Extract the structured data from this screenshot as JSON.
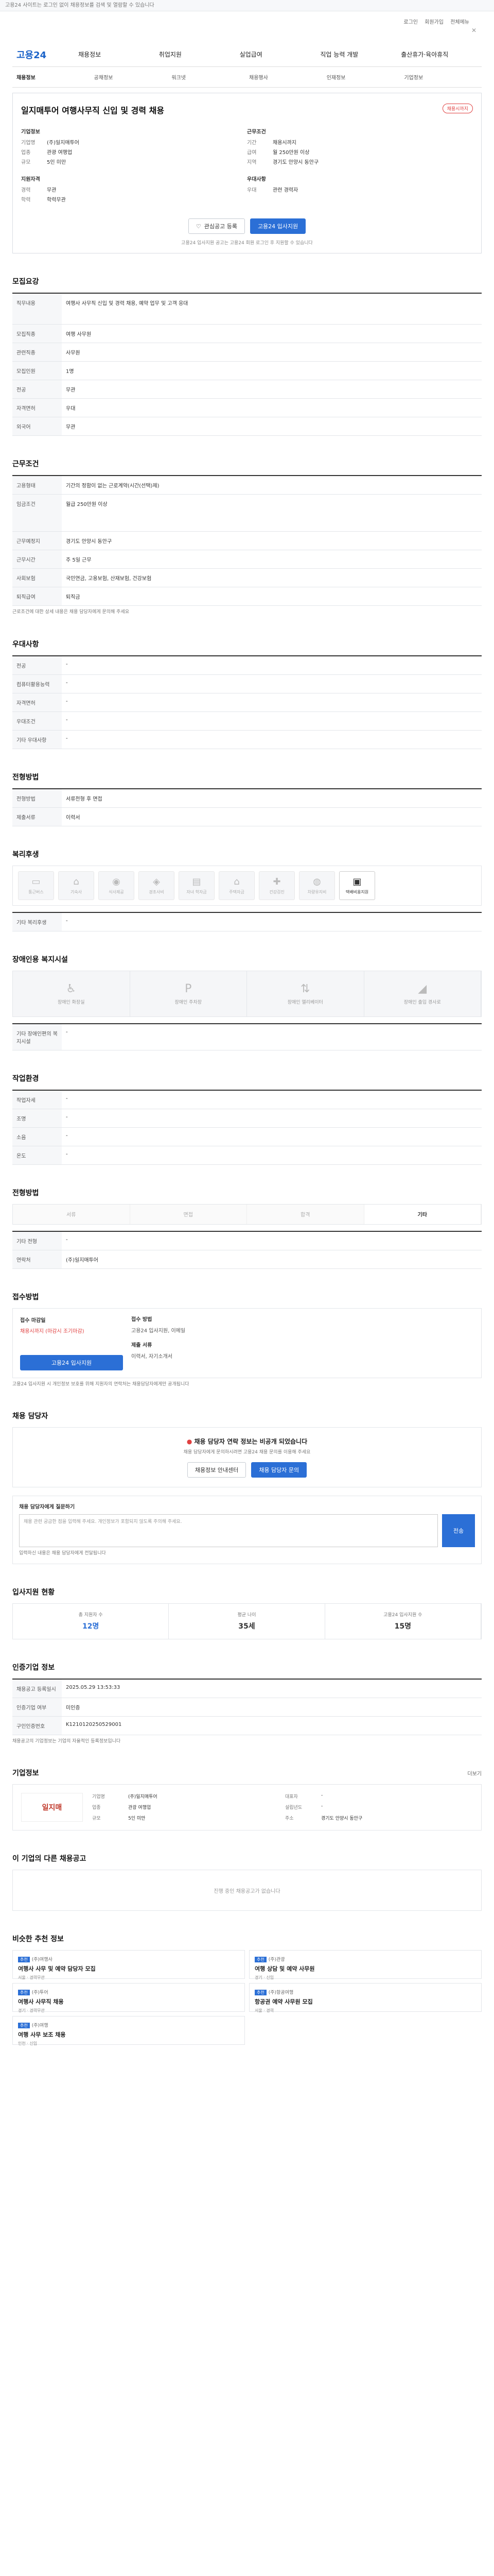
{
  "topbar": {
    "note": "고용24 사이트는 로그인 없이 채용정보를 검색 및 열람할 수 있습니다"
  },
  "util": {
    "links": [
      "로그인",
      "회원가입",
      "전체메뉴"
    ],
    "close": "✕"
  },
  "brand": {
    "logo": "고용24"
  },
  "gnb": [
    "채용정보",
    "취업지원",
    "실업급여",
    "직업 능력 개발",
    "출산휴가·육아휴직"
  ],
  "subnav": [
    "채용정보",
    "공채정보",
    "워크넷",
    "채용행사",
    "인재정보",
    "기업정보"
  ],
  "job": {
    "title": "일지매투어 여행사무직 신입 및 경력 채용",
    "deadline_badge": "채용시까지",
    "company_h": "기업정보",
    "company": [
      [
        "기업명",
        "(주)일지매투어"
      ],
      [
        "업종",
        "관광 여행업"
      ],
      [
        "규모",
        "5인 미만"
      ]
    ],
    "work_h": "근무조건",
    "work": [
      [
        "기간",
        "채용시까지"
      ],
      [
        "급여",
        "월 250만원 이상"
      ],
      [
        "지역",
        "경기도 안양시 동안구"
      ]
    ],
    "req_h": "지원자격",
    "req": [
      [
        "경력",
        "무관"
      ],
      [
        "학력",
        "학력무관"
      ]
    ],
    "cond_h": "우대사항",
    "cond": [
      [
        "우대",
        "관련 경력자"
      ]
    ],
    "btn_scrap": "관심공고 등록",
    "btn_apply": "고용24 입사지원",
    "note": "고용24 입사지원 공고는 고용24 회원 로그인 후 지원할 수 있습니다"
  },
  "sec_recruit": {
    "h": "모집요강",
    "rows": [
      [
        "직무내용",
        "여행사 사무직 신입 및 경력 채용, 예약 업무 및 고객 응대"
      ],
      [
        "모집직종",
        "여행 사무원"
      ],
      [
        "관련직종",
        "사무원"
      ],
      [
        "모집인원",
        "1명"
      ],
      [
        "전공",
        "무관"
      ],
      [
        "자격면허",
        "우대"
      ],
      [
        "외국어",
        "무관"
      ]
    ]
  },
  "sec_work": {
    "h": "근무조건",
    "rows": [
      [
        "고용형태",
        "기간의 정함이 없는 근로계약(시간(선택)제)"
      ],
      [
        "임금조건",
        "월급 250만원 이상"
      ],
      [
        "근무예정지",
        "경기도 안양시 동안구"
      ],
      [
        "근무시간",
        "주 5일 근무"
      ],
      [
        "사회보험",
        "국민연금, 고용보험, 산재보험, 건강보험"
      ],
      [
        "퇴직급여",
        "퇴직금"
      ]
    ],
    "note": "근로조건에 대한 상세 내용은 채용 담당자에게 문의해 주세요"
  },
  "sec_pref": {
    "h": "우대사항",
    "rows": [
      [
        "전공",
        "-"
      ],
      [
        "컴퓨터활용능력",
        "-"
      ],
      [
        "자격면허",
        "-"
      ],
      [
        "우대조건",
        "-"
      ],
      [
        "기타 우대사항",
        "-"
      ]
    ]
  },
  "sec_docs": {
    "h": "전형방법",
    "rows": [
      [
        "전형방법",
        "서류전형 후 면접"
      ],
      [
        "제출서류",
        "이력서"
      ]
    ]
  },
  "sec_welfare": {
    "h": "복리후생",
    "items": [
      "통근버스",
      "기숙사",
      "식사제공",
      "경조사비",
      "자녀 학자금",
      "주택자금",
      "건강검진",
      "차량유지비",
      "택배비용지원"
    ],
    "active": "택배비용지원",
    "extra_k": "기타 복리후생",
    "extra_v": "-"
  },
  "sec_disabled": {
    "h": "장애인용 복지시설",
    "items": [
      "장애인 화장실",
      "장애인 주차장",
      "장애인 엘리베이터",
      "장애인 출입 경사로"
    ],
    "extra_k": "기타 장애인편의 복지시설",
    "extra_v": "-"
  },
  "sec_env": {
    "h": "작업환경",
    "rows": [
      [
        "작업자세",
        "-"
      ],
      [
        "조명",
        "-"
      ],
      [
        "소음",
        "-"
      ],
      [
        "온도",
        "-"
      ]
    ]
  },
  "sec_select": {
    "h": "전형방법",
    "steps": [
      "서류",
      "면접",
      "합격",
      "기타"
    ],
    "active": "기타",
    "rows": [
      [
        "기타 전형",
        "-"
      ],
      [
        "연락처",
        "(주)일지매투어"
      ]
    ]
  },
  "sec_applyinfo": {
    "h": "접수방법",
    "deadline_k": "접수 마감일",
    "deadline_v": "채용시까지 (마감시 조기마감)",
    "apply_btn": "고용24 입사지원",
    "method_k": "접수 방법",
    "method_v": "고용24 입사지원, 이메일",
    "docs_k": "제출 서류",
    "docs_v": "이력서, 자기소개서",
    "notes": "고용24 입사지원 시 개인정보 보호를 위해 지원자의 연락처는 채용담당자에게만 공개됩니다"
  },
  "sec_manager": {
    "h": "채용 담당자",
    "notice_title": "채용 담당자 연락 정보는 비공개 되었습니다",
    "notice_sub": "채용 담당자에게 문의하시려면 고용24 채용 문의를 이용해 주세요",
    "btn1": "채용정보 안내센터",
    "btn2": "채용 담당자 문의",
    "q_h": "채용 담당자에게 질문하기",
    "q_placeholder": "채용 관련 궁금한 점을 입력해 주세요. 개인정보가 포함되지 않도록 주의해 주세요.",
    "q_btn": "전송",
    "q_note": "입력하신 내용은 채용 담당자에게 전달됩니다"
  },
  "sec_stats": {
    "h": "입사지원 현황",
    "items": [
      [
        "총 지원자 수",
        "12명"
      ],
      [
        "평균 나이",
        "35세"
      ],
      [
        "고용24 입사지원 수",
        "15명"
      ]
    ]
  },
  "sec_info": {
    "h": "인증기업 정보",
    "rows": [
      [
        "채용공고 등록일시",
        "2025.05.29 13:53:33"
      ],
      [
        "인증기업 여부",
        "미인증"
      ],
      [
        "구인인증번호",
        "K1210120250529001"
      ]
    ],
    "note": "채용공고의 기업정보는 기업의 자율적인 등록정보입니다"
  },
  "sec_corp": {
    "h": "기업정보",
    "more": "더보기",
    "logo": "일지매",
    "grid": [
      [
        "기업명",
        "(주)일지매투어"
      ],
      [
        "대표자",
        "-"
      ],
      [
        "업종",
        "관광 여행업"
      ],
      [
        "설립년도",
        "-"
      ],
      [
        "규모",
        "5인 미만"
      ],
      [
        "주소",
        "경기도 안양시 동안구"
      ]
    ]
  },
  "sec_same": {
    "h": "이 기업의 다른 채용공고",
    "empty": "진행 중인 채용공고가 없습니다"
  },
  "sec_reco": {
    "h": "비슷한 추천 정보",
    "items": [
      {
        "badge": "추천",
        "co": "(주)여행사",
        "t": "여행사 사무 및 예약 담당자 모집",
        "m": "서울 · 경력무관"
      },
      {
        "badge": "추천",
        "co": "(주)관광",
        "t": "여행 상담 및 예약 사무원",
        "m": "경기 · 신입"
      },
      {
        "badge": "추천",
        "co": "(주)투어",
        "t": "여행사 사무직 채용",
        "m": "경기 · 경력무관"
      },
      {
        "badge": "추천",
        "co": "(주)항공여행",
        "t": "항공권 예약 사무원 모집",
        "m": "서울 · 경력"
      },
      {
        "badge": "추천",
        "co": "(주)여행",
        "t": "여행 사무 보조 채용",
        "m": "인천 · 신입"
      }
    ]
  }
}
